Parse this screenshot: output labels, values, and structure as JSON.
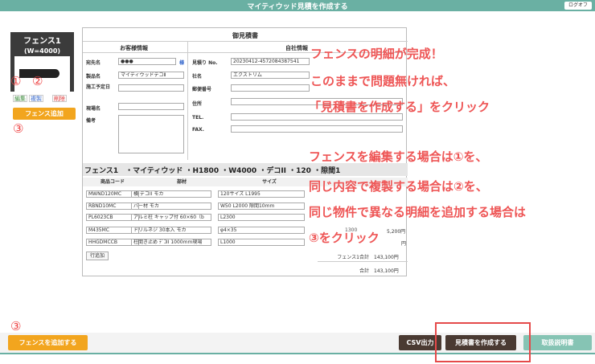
{
  "header": {
    "title": "マイティウッド見積を作成する",
    "logout_label": "ログオフ"
  },
  "sidebar": {
    "fence_name": "フェンス1",
    "fence_width": "(W=4000)",
    "marker_1": "①",
    "marker_2": "②",
    "marker_3": "③",
    "edit_label": "編集",
    "copy_label": "複製",
    "delete_label": "削除",
    "add_label": "フェンス追加"
  },
  "estimate": {
    "title": "御見積書",
    "customer_header": "お客様情報",
    "company_header": "自社情報",
    "customer": {
      "addressee_label": "宛先名",
      "addressee_value": "●●●",
      "honorific": "様",
      "product_label": "製品名",
      "product_value": "マイティウッドデコⅡ",
      "owner_label": "施工予定日",
      "site_label": "現場名",
      "notes_label": "備考"
    },
    "company": {
      "no_label": "見積り No.",
      "no_value": "20230412-4572084387541",
      "name_label": "社名",
      "name_value": "エクストリム",
      "zip_label": "郵便番号",
      "addr_label": "住所",
      "tel_label": "TEL.",
      "fax_label": "FAX."
    },
    "fence_line": "フェンス1　・マイティウッド ・H1800 ・W4000 ・デコII ・120 ・隙間1",
    "columns": [
      "商品コード",
      "部材",
      "サイズ"
    ],
    "rows": [
      {
        "code": "MWND120MC",
        "part": "横 デコII モカ",
        "size": "120サイズ L1995"
      },
      {
        "code": "RBND10MC",
        "part": "バー材 モカ",
        "size": "W50 L2000 隙間10mm"
      },
      {
        "code": "PL6023CB",
        "part": "アルミ柱 キャップ付 60×60（b",
        "size": "L2300"
      },
      {
        "code": "M435MC",
        "part": "ドリルネジ 30本入 モカ",
        "size": "φ4×35"
      },
      {
        "code": "HHGDMCCB",
        "part": "柱間き止め ﾃﾞｺII 1000mm現場",
        "size": "L1000"
      }
    ],
    "row_add_label": "行追加",
    "partial_values": [
      "1300",
      "5,200円",
      "円"
    ],
    "fence_total_label": "フェンス1合計",
    "fence_total_value": "143,100円",
    "total_label": "合計",
    "total_value": "143,100円"
  },
  "notes": {
    "line1": "フェンスの明細が完成！",
    "line2": "このままで問題無ければ、",
    "line3": "「見積書を作成する」をクリック",
    "line4": "フェンスを編集する場合は①を、",
    "line5": "同じ内容で複製する場合は②を、",
    "line6": "同じ物件で異なる明細を追加する場合は",
    "line7": "③をクリック"
  },
  "bottom": {
    "marker_3": "③",
    "add_fence_label": "フェンスを追加する",
    "csv_label": "CSV出力",
    "create_label": "見積書を作成する",
    "manual_label": "取扱説明書"
  },
  "colors": {
    "accent": "#6ab0a3",
    "orange": "#f2a51e",
    "dark_button": "#4a3a32",
    "note_red": "#ee5555"
  }
}
